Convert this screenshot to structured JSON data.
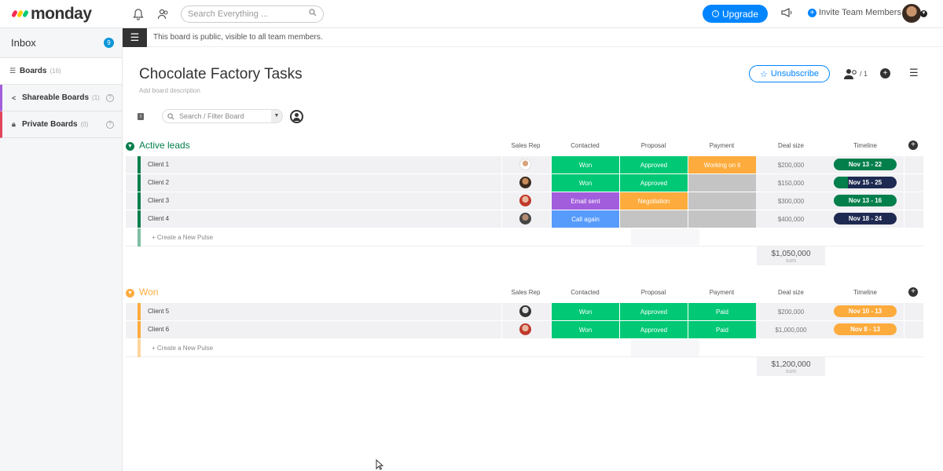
{
  "app": {
    "logo_text": "monday"
  },
  "topbar": {
    "search_placeholder": "Search Everything ...",
    "upgrade_label": "Upgrade",
    "invite_label": "Invite Team Members"
  },
  "sidebar": {
    "inbox_label": "Inbox",
    "inbox_count": "9",
    "items": [
      {
        "label": "Boards",
        "count": "(16)"
      },
      {
        "label": "Shareable Boards",
        "count": "(1)"
      },
      {
        "label": "Private Boards",
        "count": "(0)"
      }
    ]
  },
  "notice": {
    "text": "This board is public, visible to all team members."
  },
  "board": {
    "title": "Chocolate Factory Tasks",
    "description": "Add board description",
    "unsubscribe_label": "Unsubscribe",
    "members_count": "/ 1",
    "filter_placeholder": "Search / Filter Board"
  },
  "columns": [
    "Sales Rep",
    "Contacted",
    "Proposal",
    "Payment",
    "Deal size",
    "Timeline"
  ],
  "colors": {
    "green": "#00c875",
    "orange": "#fdab3d",
    "purple": "#a25ddc",
    "blue": "#579bfc",
    "grey": "#c4c4c4",
    "dark_green": "#037f4c",
    "navy": "#1f2a52",
    "brand_blue": "#0085ff"
  },
  "groups": [
    {
      "title": "Active leads",
      "color": "#037f4c",
      "new_pulse": "+ Create a New Pulse",
      "sum_value": "$1,050,000",
      "sum_label": "sum",
      "rows": [
        {
          "name": "Client 1",
          "contacted": "Won",
          "proposal": "Approved",
          "payment": "Working on it",
          "deal": "$200,000",
          "timeline": "Nov 13 - 22"
        },
        {
          "name": "Client 2",
          "contacted": "Won",
          "proposal": "Approved",
          "payment": "",
          "deal": "$150,000",
          "timeline": "Nov 15 - 25"
        },
        {
          "name": "Client 3",
          "contacted": "Email sent",
          "proposal": "Negotiation",
          "payment": "",
          "deal": "$300,000",
          "timeline": "Nov 13 - 16"
        },
        {
          "name": "Client 4",
          "contacted": "Call again",
          "proposal": "",
          "payment": "",
          "deal": "$400,000",
          "timeline": "Nov 18 - 24"
        }
      ]
    },
    {
      "title": "Won",
      "color": "#fdab3d",
      "new_pulse": "+ Create a New Pulse",
      "sum_value": "$1,200,000",
      "sum_label": "sum",
      "rows": [
        {
          "name": "Client 5",
          "contacted": "Won",
          "proposal": "Approved",
          "payment": "Paid",
          "deal": "$200,000",
          "timeline": "Nov 10 - 13"
        },
        {
          "name": "Client 6",
          "contacted": "Won",
          "proposal": "Approved",
          "payment": "Paid",
          "deal": "$1,000,000",
          "timeline": "Nov 8 - 13"
        }
      ]
    }
  ]
}
